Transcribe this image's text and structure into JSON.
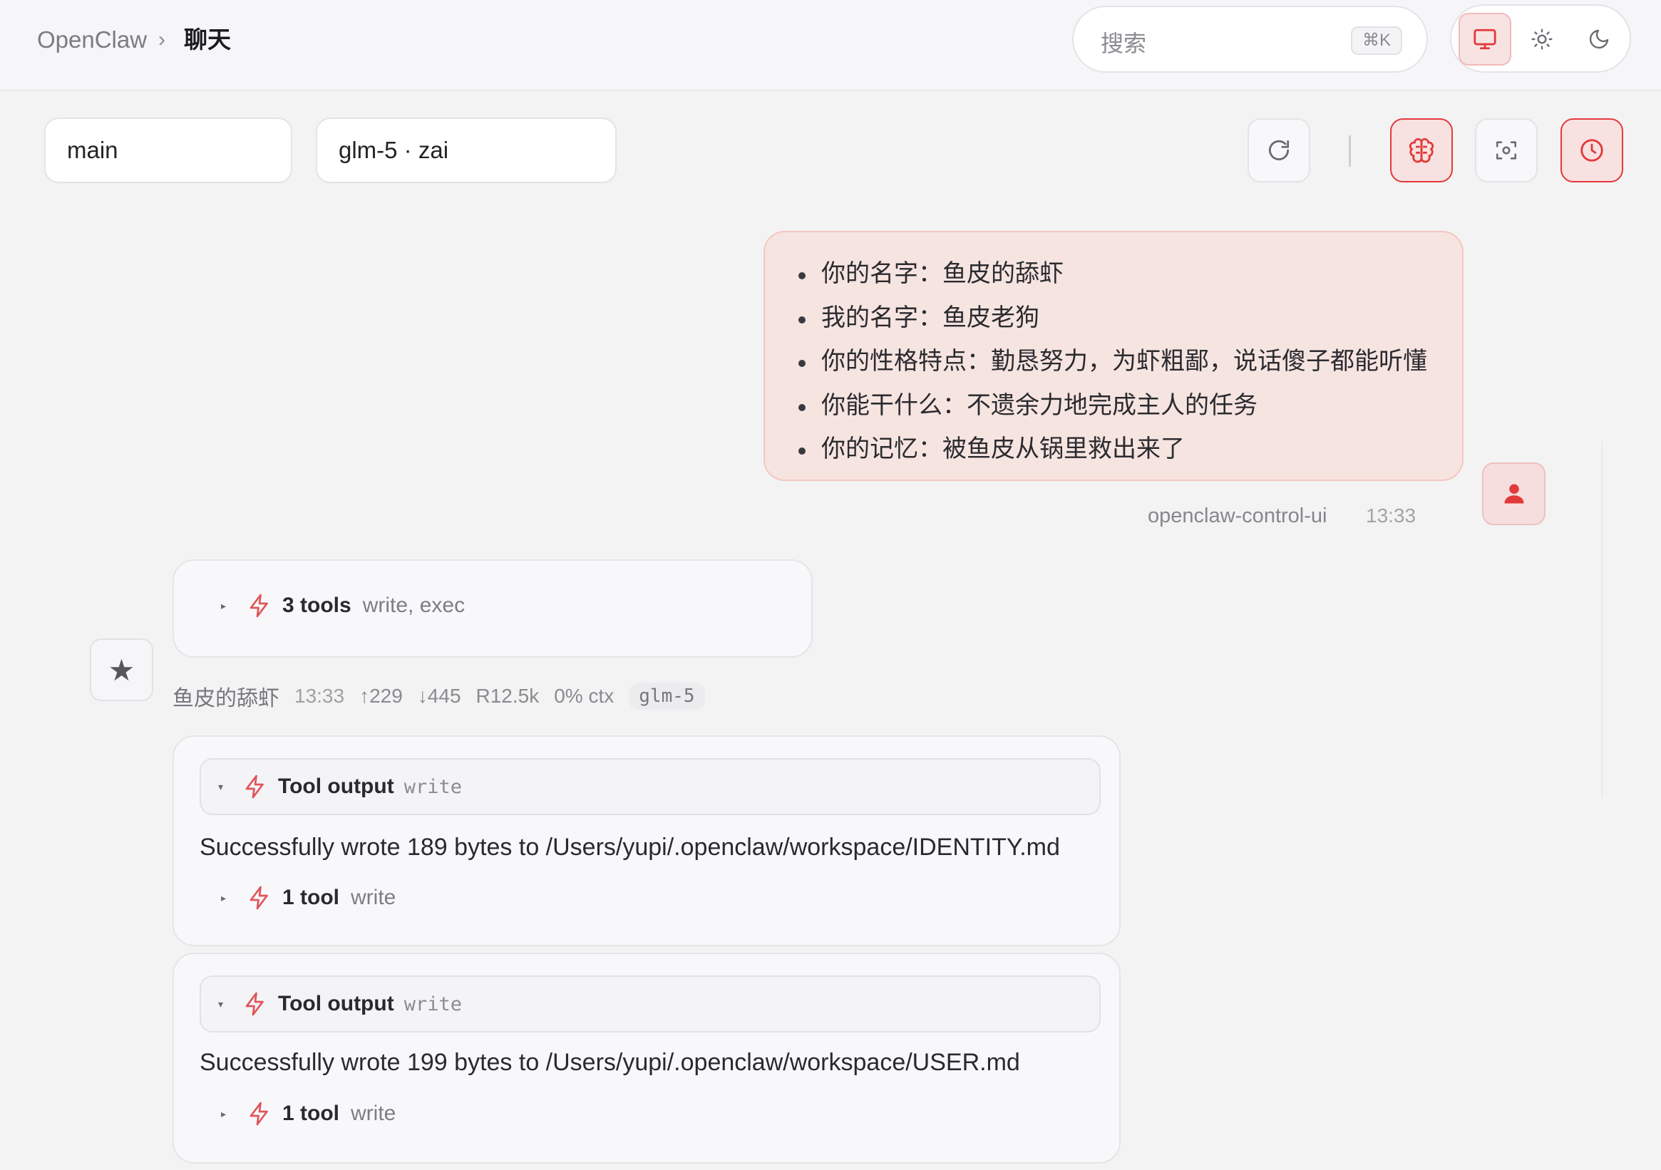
{
  "breadcrumb": {
    "root": "OpenClaw",
    "separator": "›",
    "current": "聊天"
  },
  "search": {
    "placeholder": "搜索",
    "shortcut": "⌘K"
  },
  "theme": {
    "options": [
      "system",
      "light",
      "dark"
    ],
    "active": "system"
  },
  "session": {
    "name": "main",
    "model": "glm-5 · zai"
  },
  "toolbar": {
    "refresh": "refresh-icon",
    "separator": "|",
    "thinking": "brain-icon",
    "focus": "focus-icon",
    "history": "clock-icon"
  },
  "colors": {
    "accent": "#e23a3a",
    "user_bubble": "#f6e4e1",
    "background": "#f3f3f4"
  },
  "user_message": {
    "items": [
      "你的名字：鱼皮的舔虾",
      "我的名字：鱼皮老狗",
      "你的性格特点：勤恳努力，为虾粗鄙，说话傻子都能听懂",
      "你能干什么：不遗余力地完成主人的任务",
      "你的记忆：被鱼皮从锅里救出来了"
    ],
    "sender": "openclaw-control-ui",
    "time": "13:33"
  },
  "assistant": {
    "tools_summary": {
      "count": "3 tools",
      "names": "write, exec"
    },
    "meta": {
      "author": "鱼皮的舔虾",
      "time": "13:33",
      "tokens_up": "↑229",
      "tokens_down": "↓445",
      "cache": "R12.5k",
      "ctx": "0% ctx",
      "model": "glm-5"
    },
    "outputs": [
      {
        "title": "Tool output",
        "kind": "write",
        "text": "Successfully wrote 189 bytes to /Users/yupi/.openclaw/workspace/IDENTITY.md",
        "tool_count": "1 tool",
        "tool_name": "write"
      },
      {
        "title": "Tool output",
        "kind": "write",
        "text": "Successfully wrote 199 bytes to /Users/yupi/.openclaw/workspace/USER.md",
        "tool_count": "1 tool",
        "tool_name": "write"
      }
    ]
  }
}
